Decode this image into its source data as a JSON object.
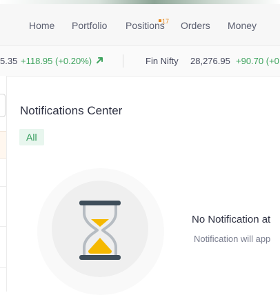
{
  "nav": {
    "items": [
      {
        "label": "Home"
      },
      {
        "label": "Portfolio"
      },
      {
        "label": "Positions"
      },
      {
        "label": "Orders"
      },
      {
        "label": "Money"
      }
    ],
    "positions_badge": "17"
  },
  "ticker": {
    "items": [
      {
        "value": "5.35",
        "change": "+118.95 (+0.20%)",
        "direction": "up"
      },
      {
        "name": "Fin Nifty",
        "value": "28,276.95",
        "change": "+90.70 (+0"
      }
    ]
  },
  "notifications": {
    "title": "Notifications Center",
    "filters": [
      "All"
    ],
    "empty_title": "No Notification at",
    "empty_subtitle": "Notification will app",
    "empty_icon": "hourglass-icon"
  },
  "colors": {
    "positive": "#3da35d",
    "badge": "#e6871a",
    "chip_bg": "#e8f6ee",
    "hourglass_sand": "#f5b800"
  }
}
